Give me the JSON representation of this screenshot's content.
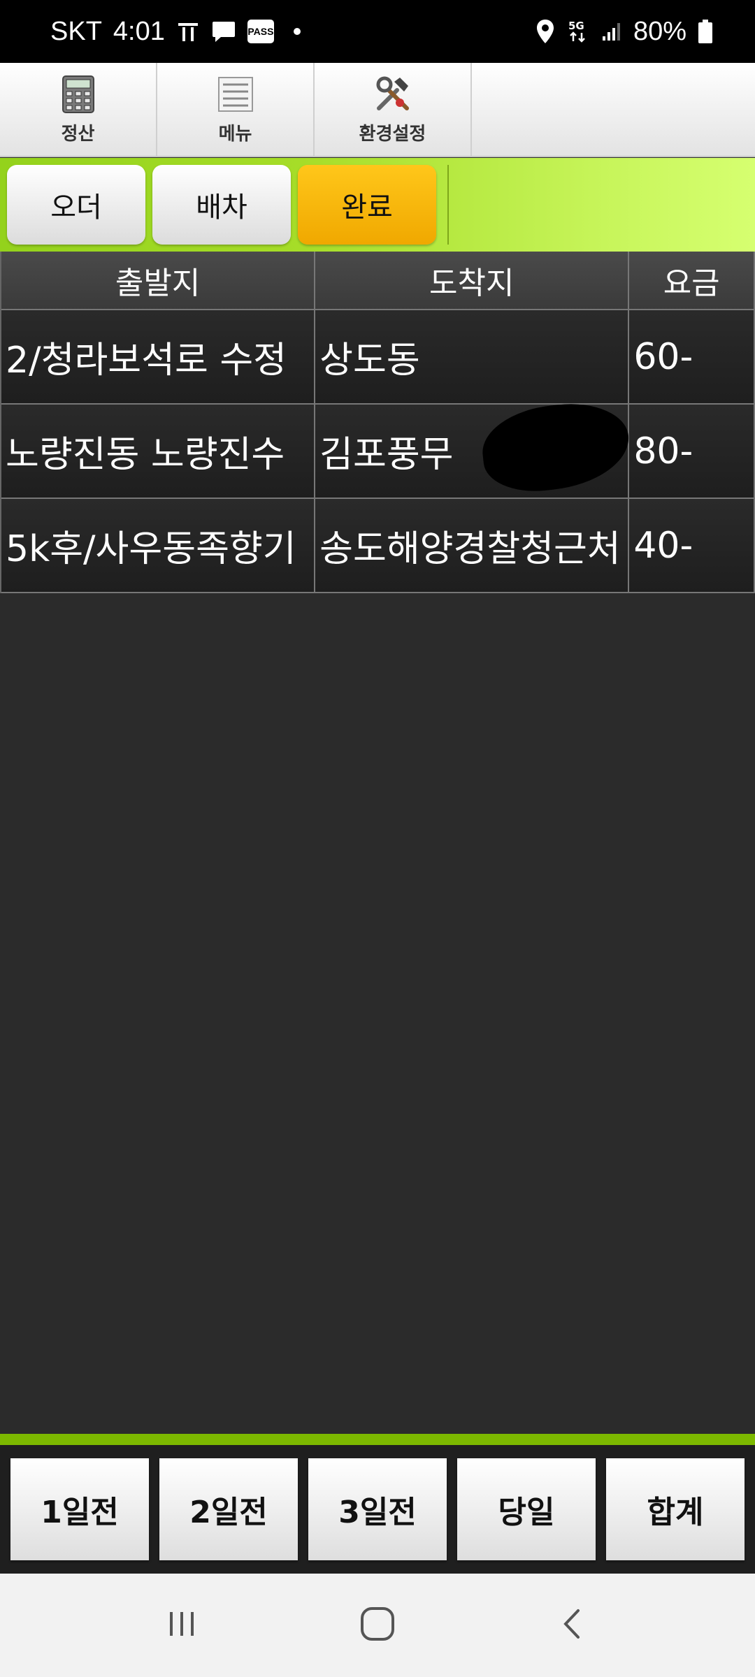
{
  "status_bar": {
    "carrier": "SKT",
    "time": "4:01",
    "pass_label": "PASS",
    "network": "5G",
    "battery": "80%"
  },
  "toolbar": {
    "items": [
      {
        "label": "정산",
        "icon": "calculator-icon"
      },
      {
        "label": "메뉴",
        "icon": "list-icon"
      },
      {
        "label": "환경설정",
        "icon": "tools-icon"
      }
    ]
  },
  "tabs": [
    {
      "label": "오더",
      "active": false
    },
    {
      "label": "배차",
      "active": false
    },
    {
      "label": "완료",
      "active": true
    }
  ],
  "table": {
    "headers": [
      "출발지",
      "도착지",
      "요금"
    ],
    "rows": [
      [
        "2/청라보석로 수정",
        "상도동",
        "60-"
      ],
      [
        "노량진동 노량진수",
        "김포풍무",
        "80-"
      ],
      [
        "5k후/사우동족향기",
        "송도해양경찰청근처",
        "40-"
      ]
    ]
  },
  "bottom_buttons": [
    "1일전",
    "2일전",
    "3일전",
    "당일",
    "합계"
  ],
  "colors": {
    "accent_green": "#9ed61f",
    "active_tab": "#f5b400",
    "table_bg": "#222222"
  }
}
